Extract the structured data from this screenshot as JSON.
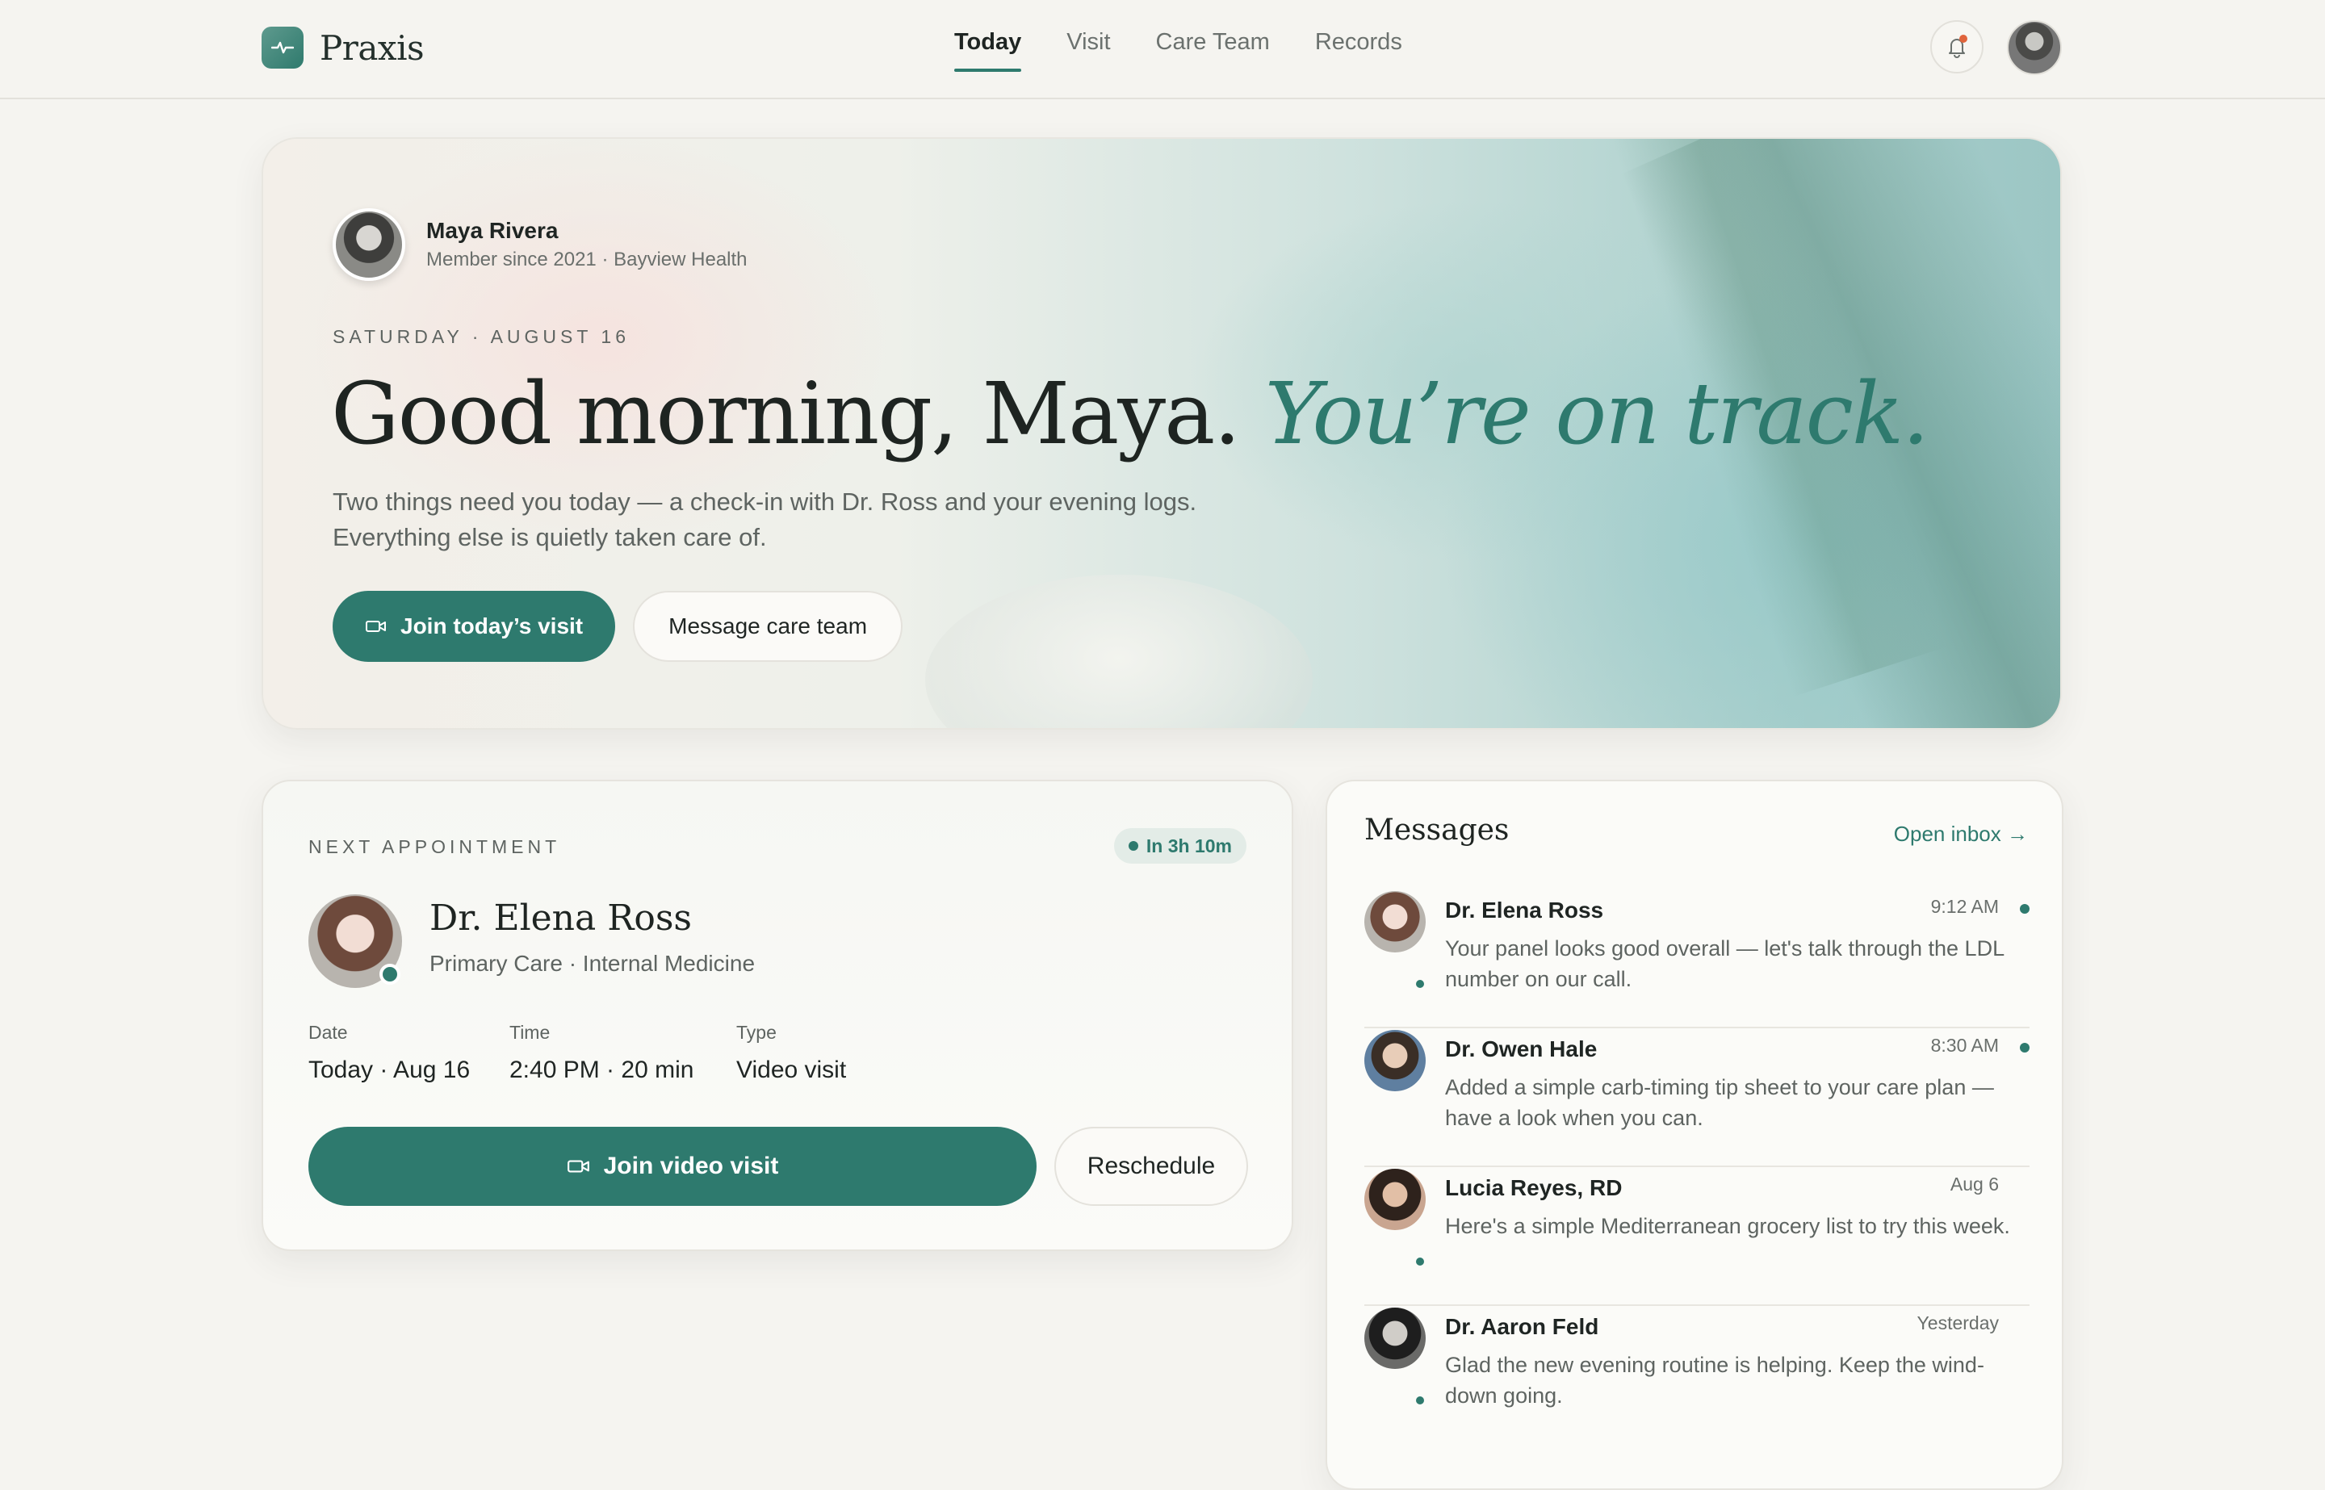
{
  "app": {
    "name": "Praxis"
  },
  "nav": {
    "items": [
      {
        "label": "Today",
        "active": true
      },
      {
        "label": "Visit",
        "active": false
      },
      {
        "label": "Care Team",
        "active": false
      },
      {
        "label": "Records",
        "active": false
      }
    ]
  },
  "header": {
    "bell_icon": "bell-icon",
    "notification_dot_color": "#e0643c"
  },
  "hero": {
    "user_name": "Maya Rivera",
    "user_sub": "Member since 2021 · Bayview Health",
    "date": "SATURDAY · AUGUST 16",
    "greeting": "Good morning, Maya.",
    "greeting_accent": "You’re on track.",
    "description_line1": "Two things need you today — a check-in with Dr. Ross and your evening logs.",
    "description_line2": "Everything else is quietly taken care of.",
    "primary_button": "Join today’s visit",
    "secondary_button": "Message care team"
  },
  "appointment": {
    "label": "NEXT APPOINTMENT",
    "badge": "In 3h 10m",
    "doctor_name": "Dr. Elena Ross",
    "doctor_specialty": "Primary Care · Internal Medicine",
    "details": [
      {
        "key": "Date",
        "value": "Today · Aug 16"
      },
      {
        "key": "Time",
        "value": "2:40 PM · 20 min"
      },
      {
        "key": "Type",
        "value": "Video visit"
      }
    ],
    "join_button": "Join video visit",
    "reschedule_button": "Reschedule"
  },
  "messages": {
    "title": "Messages",
    "open_inbox": "Open inbox →",
    "items": [
      {
        "name": "Dr. Elena Ross",
        "time": "9:12 AM",
        "unread": true,
        "text": "Your panel looks good overall — let's talk through the LDL number on our call."
      },
      {
        "name": "Dr. Owen Hale",
        "time": "8:30 AM",
        "unread": true,
        "text": "Added a simple carb-timing tip sheet to your care plan — have a look when you can."
      },
      {
        "name": "Lucia Reyes, RD",
        "time": "Aug 6",
        "unread": false,
        "text": "Here's a simple Mediterranean grocery list to try this week."
      },
      {
        "name": "Dr. Aaron Feld",
        "time": "Yesterday",
        "unread": false,
        "text": "Glad the new evening routine is helping. Keep the wind-down going."
      }
    ]
  },
  "colors": {
    "accent": "#2e7a6e",
    "background": "#f5f4f0"
  }
}
